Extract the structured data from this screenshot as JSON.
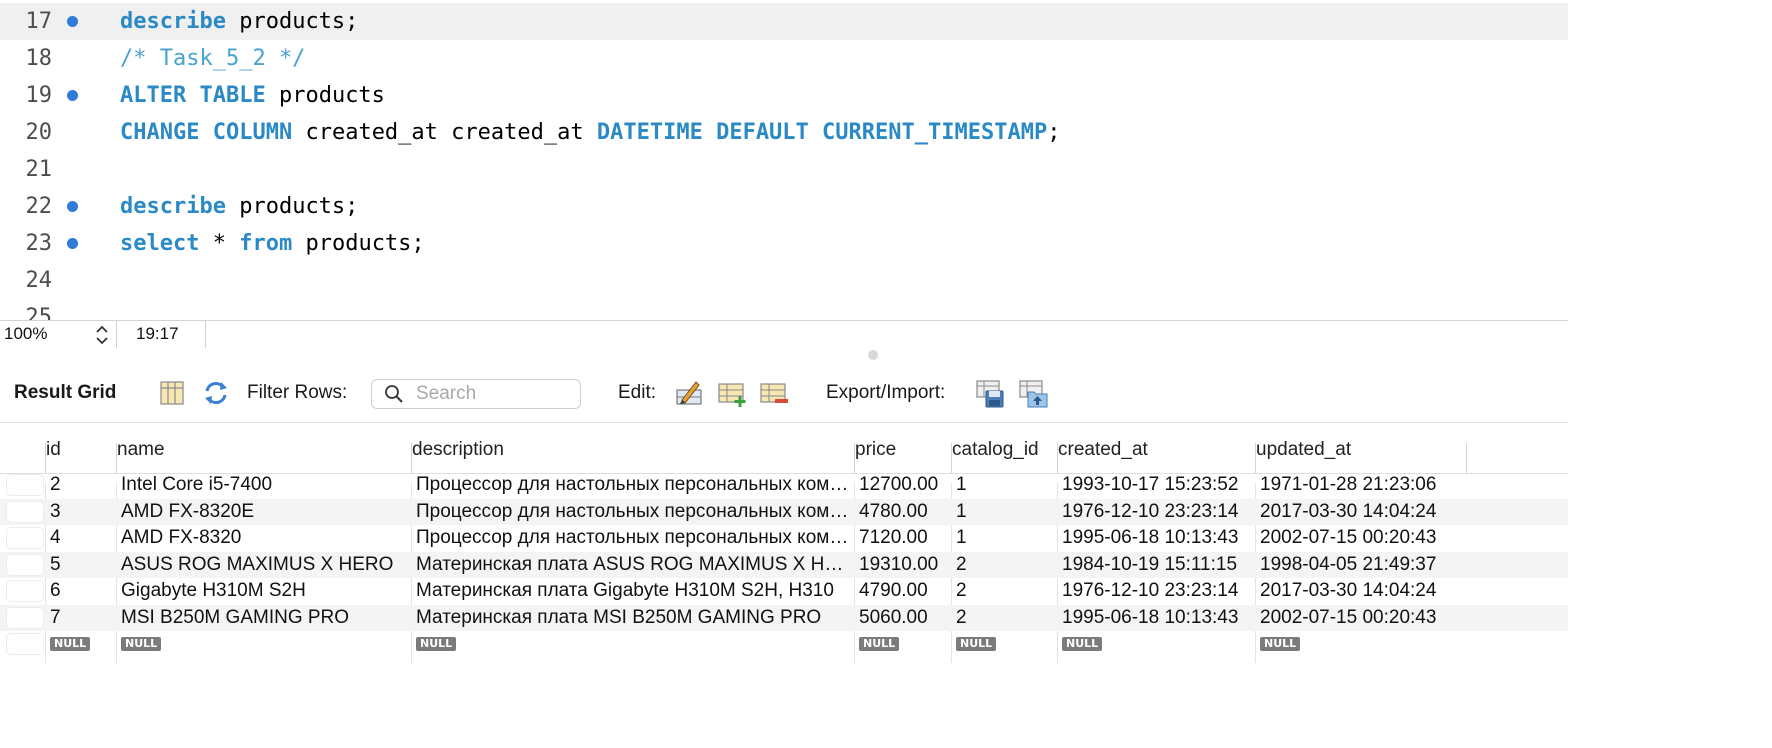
{
  "editor": {
    "lines": [
      {
        "no": "17",
        "marker": true,
        "current": true,
        "tokens": [
          {
            "t": "describe",
            "k": "kw"
          },
          {
            "t": " products;",
            "k": ""
          }
        ]
      },
      {
        "no": "18",
        "marker": false,
        "current": false,
        "tokens": [
          {
            "t": "/* Task_5_2 */",
            "k": "cm"
          }
        ]
      },
      {
        "no": "19",
        "marker": true,
        "current": false,
        "tokens": [
          {
            "t": "ALTER",
            "k": "kw"
          },
          {
            "t": " ",
            "k": ""
          },
          {
            "t": "TABLE",
            "k": "kw"
          },
          {
            "t": " products",
            "k": ""
          }
        ]
      },
      {
        "no": "20",
        "marker": false,
        "current": false,
        "tokens": [
          {
            "t": "CHANGE",
            "k": "kw"
          },
          {
            "t": " ",
            "k": ""
          },
          {
            "t": "COLUMN",
            "k": "kw"
          },
          {
            "t": " created_at created_at ",
            "k": ""
          },
          {
            "t": "DATETIME",
            "k": "kw"
          },
          {
            "t": " ",
            "k": ""
          },
          {
            "t": "DEFAULT",
            "k": "kw"
          },
          {
            "t": " ",
            "k": ""
          },
          {
            "t": "CURRENT_TIMESTAMP",
            "k": "kw"
          },
          {
            "t": ";",
            "k": ""
          }
        ]
      },
      {
        "no": "21",
        "marker": false,
        "current": false,
        "tokens": []
      },
      {
        "no": "22",
        "marker": true,
        "current": false,
        "tokens": [
          {
            "t": "describe",
            "k": "kw"
          },
          {
            "t": " products;",
            "k": ""
          }
        ]
      },
      {
        "no": "23",
        "marker": true,
        "current": false,
        "tokens": [
          {
            "t": "select",
            "k": "kw"
          },
          {
            "t": " * ",
            "k": ""
          },
          {
            "t": "from",
            "k": "kw"
          },
          {
            "t": " products;",
            "k": ""
          }
        ]
      },
      {
        "no": "24",
        "marker": false,
        "current": false,
        "tokens": []
      },
      {
        "no": "25",
        "marker": false,
        "current": false,
        "tokens": []
      }
    ]
  },
  "status": {
    "zoom": "100%",
    "cursor": "19:17"
  },
  "toolbar": {
    "title": "Result Grid",
    "filter_label": "Filter Rows:",
    "search_placeholder": "Search",
    "edit_label": "Edit:",
    "export_label": "Export/Import:"
  },
  "grid": {
    "columns": [
      "id",
      "name",
      "description",
      "price",
      "catalog_id",
      "created_at",
      "updated_at"
    ],
    "rows": [
      [
        "2",
        "Intel Core i5-7400",
        "Процессор для настольных персональных компьютеров",
        "12700.00",
        "1",
        "1993-10-17 15:23:52",
        "1971-01-28 21:23:06"
      ],
      [
        "3",
        "AMD FX-8320E",
        "Процессор для настольных персональных компьютеров",
        "4780.00",
        "1",
        "1976-12-10 23:23:14",
        "2017-03-30 14:04:24"
      ],
      [
        "4",
        "AMD FX-8320",
        "Процессор для настольных персональных компьютеров",
        "7120.00",
        "1",
        "1995-06-18 10:13:43",
        "2002-07-15 00:20:43"
      ],
      [
        "5",
        "ASUS ROG MAXIMUS X HERO",
        "Материнская плата ASUS ROG MAXIMUS X HERO",
        "19310.00",
        "2",
        "1984-10-19 15:11:15",
        "1998-04-05 21:49:37"
      ],
      [
        "6",
        "Gigabyte H310M S2H",
        "Материнская плата Gigabyte H310M S2H, H310",
        "4790.00",
        "2",
        "1976-12-10 23:23:14",
        "2017-03-30 14:04:24"
      ],
      [
        "7",
        "MSI B250M GAMING PRO",
        "Материнская плата MSI B250M GAMING PRO",
        "5060.00",
        "2",
        "1995-06-18 10:13:43",
        "2002-07-15 00:20:43"
      ]
    ],
    "null_label": "NULL"
  }
}
